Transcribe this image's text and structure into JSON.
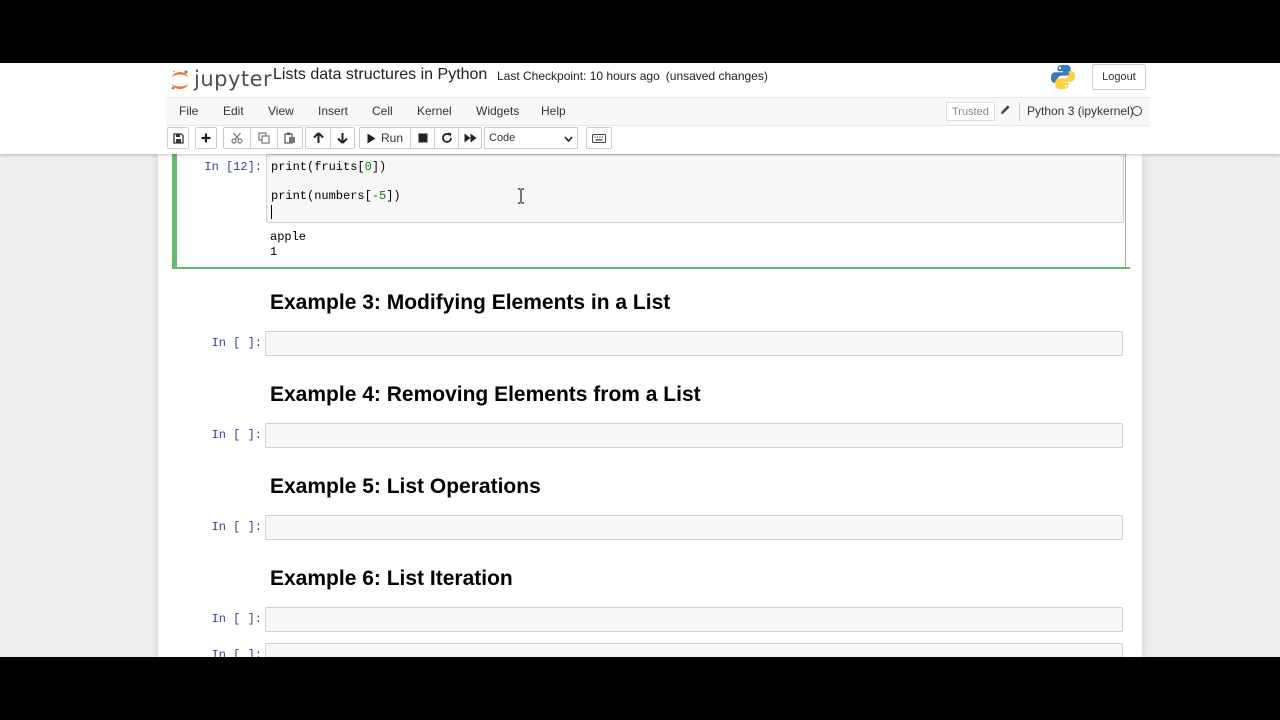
{
  "header": {
    "logo_text": "jupyter",
    "notebook_title": "Lists data structures in Python",
    "checkpoint": "Last Checkpoint: 10 hours ago",
    "unsaved": "(unsaved changes)",
    "logout_label": "Logout"
  },
  "menu": {
    "items": [
      "File",
      "Edit",
      "View",
      "Insert",
      "Cell",
      "Kernel",
      "Widgets",
      "Help"
    ],
    "trusted": "Trusted",
    "kernel_name": "Python 3 (ipykernel)"
  },
  "toolbar": {
    "run_label": "Run",
    "cell_type": "Code",
    "buttons": [
      "save-icon",
      "plus-icon",
      "cut-icon",
      "copy-icon",
      "paste-icon",
      "arrow-up-icon",
      "arrow-down-icon",
      "play-icon",
      "stop-icon",
      "restart-icon",
      "fast-forward-icon",
      "keyboard-icon"
    ]
  },
  "cells": {
    "active": {
      "prompt": "In [12]:",
      "code_line1_pre": "print(fruits[",
      "code_line1_num": "0",
      "code_line1_post": "])",
      "code_line2_pre": "print(numbers[",
      "code_line2_num": "-5",
      "code_line2_post": "])",
      "output_line1": "apple",
      "output_line2": "1"
    },
    "sections": [
      {
        "heading": "Example 3: Modifying Elements in a List",
        "prompt": "In [ ]:"
      },
      {
        "heading": "Example 4: Removing Elements from a List",
        "prompt": "In [ ]:"
      },
      {
        "heading": "Example 5: List Operations",
        "prompt": "In [ ]:"
      },
      {
        "heading": "Example 6: List Iteration",
        "prompt": "In [ ]:"
      }
    ],
    "partial_prompt": "In [ ]:"
  },
  "colors": {
    "selected_cell": "#66bb6a",
    "prompt": "#303f9f",
    "number": "#008800"
  }
}
